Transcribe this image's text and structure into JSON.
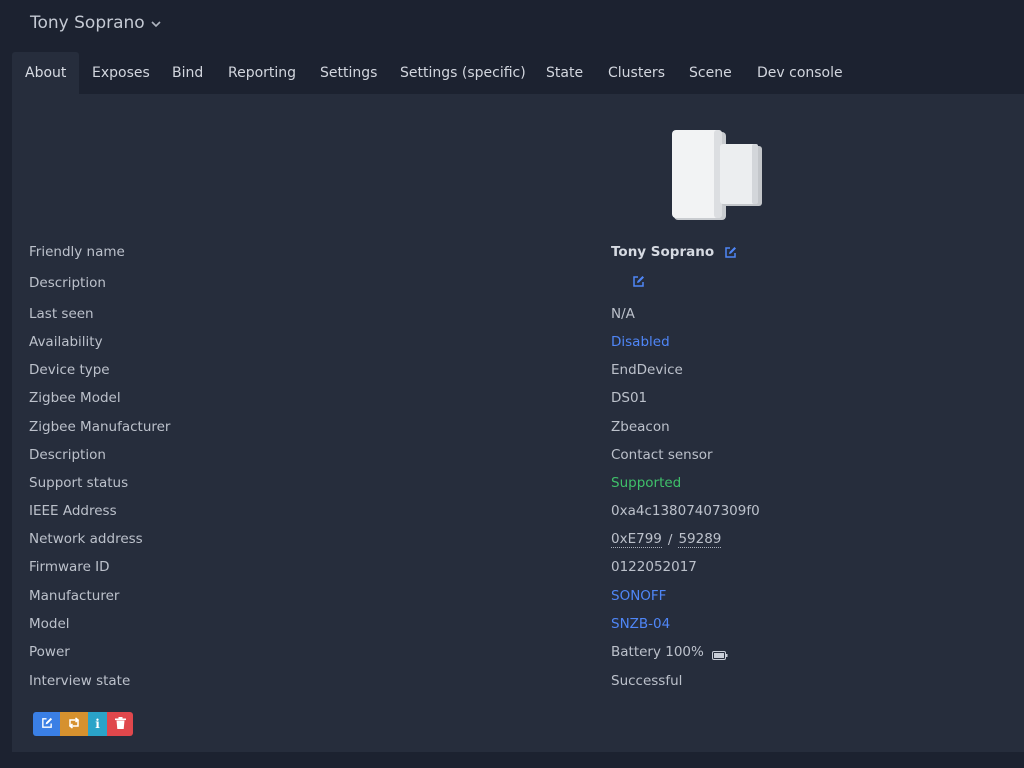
{
  "header": {
    "device_name": "Tony Soprano",
    "dropdown_icon": "chevron-down-icon"
  },
  "tabs": [
    {
      "label": "About",
      "active": true
    },
    {
      "label": "Exposes"
    },
    {
      "label": "Bind"
    },
    {
      "label": "Reporting"
    },
    {
      "label": "Settings"
    },
    {
      "label": "Settings (specific)"
    },
    {
      "label": "State"
    },
    {
      "label": "Clusters"
    },
    {
      "label": "Scene"
    },
    {
      "label": "Dev console"
    }
  ],
  "about": {
    "rows": [
      {
        "label": "Friendly name",
        "value": "Tony Soprano"
      },
      {
        "label": "Description",
        "value": ""
      },
      {
        "label": "Last seen",
        "value": "N/A"
      },
      {
        "label": "Availability",
        "value": "Disabled"
      },
      {
        "label": "Device type",
        "value": "EndDevice"
      },
      {
        "label": "Zigbee Model",
        "value": "DS01"
      },
      {
        "label": "Zigbee Manufacturer",
        "value": "Zbeacon"
      },
      {
        "label": "Description",
        "value": "Contact sensor"
      },
      {
        "label": "Support status",
        "value": "Supported"
      },
      {
        "label": "IEEE Address",
        "value": "0xa4c13807407309f0"
      },
      {
        "label": "Network address",
        "value_hex": "0xE799",
        "separator": "/",
        "value_dec": "59289"
      },
      {
        "label": "Firmware ID",
        "value": "0122052017"
      },
      {
        "label": "Manufacturer",
        "value": "SONOFF"
      },
      {
        "label": "Model",
        "value": "SNZB-04"
      },
      {
        "label": "Power",
        "value": "Battery 100%",
        "battery_level": 1.0
      },
      {
        "label": "Interview state",
        "value": "Successful"
      }
    ]
  },
  "colors": {
    "link": "#4f86f7",
    "success": "#3fc06a",
    "edit_button": "#3a7fe5",
    "reconfigure_button": "#d6912e",
    "info_button": "#2aa3c8",
    "delete_button": "#e0474c"
  },
  "actions": {
    "edit_icon": "edit-icon",
    "reconfigure_icon": "refresh-icon",
    "info_label": "i",
    "delete_icon": "trash-icon"
  }
}
